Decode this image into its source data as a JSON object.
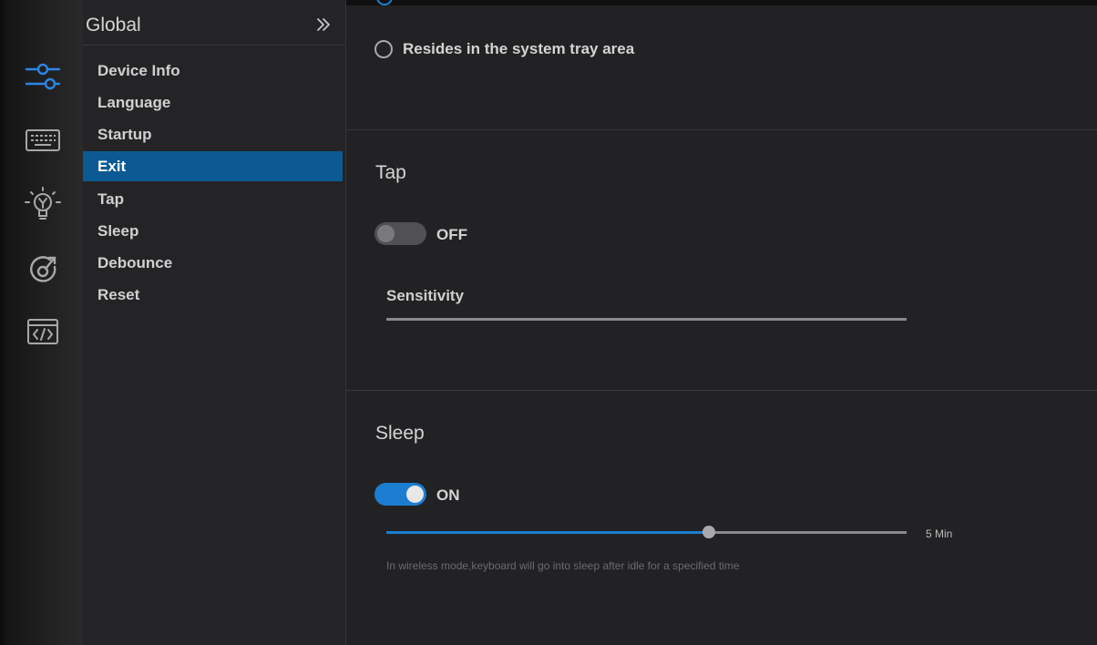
{
  "sidebar_icons": [
    {
      "name": "sliders-icon",
      "active": true
    },
    {
      "name": "keyboard-icon",
      "active": false
    },
    {
      "name": "lightbulb-icon",
      "active": false
    },
    {
      "name": "macro-icon",
      "active": false
    },
    {
      "name": "code-icon",
      "active": false
    }
  ],
  "nav": {
    "title": "Global",
    "collapse_icon": "double-chevron-right-icon",
    "items": [
      {
        "label": "Device Info",
        "active": false
      },
      {
        "label": "Language",
        "active": false
      },
      {
        "label": "Startup",
        "active": false
      },
      {
        "label": "Exit",
        "active": true
      },
      {
        "label": "Tap",
        "active": false
      },
      {
        "label": "Sleep",
        "active": false
      },
      {
        "label": "Debounce",
        "active": false
      },
      {
        "label": "Reset",
        "active": false
      }
    ]
  },
  "exit": {
    "option_tray_label": "Resides in the system tray area",
    "option_tray_selected": false
  },
  "tap": {
    "title": "Tap",
    "toggle_state": "OFF",
    "sensitivity_label": "Sensitivity"
  },
  "sleep": {
    "title": "Sleep",
    "toggle_state": "ON",
    "slider_fraction": 0.62,
    "slider_value": "5 Min",
    "hint": "In wireless mode,keyboard will go into sleep after idle for a specified time"
  },
  "colors": {
    "accent": "#1c7dd0",
    "active_nav": "#0b5a93",
    "background": "#222224"
  }
}
